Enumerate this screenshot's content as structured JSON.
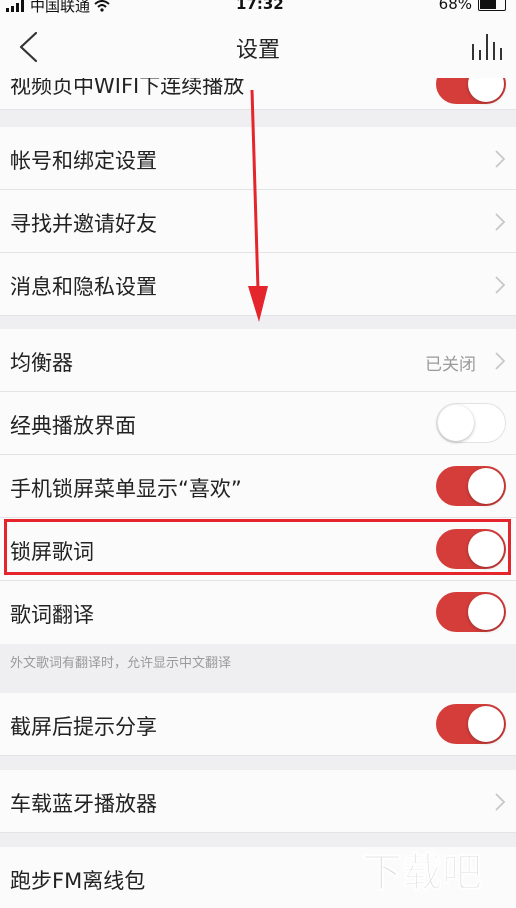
{
  "status_bar": {
    "carrier": "中国联通",
    "time": "17:32",
    "battery": "68%"
  },
  "header": {
    "title": "设置"
  },
  "rows": {
    "wifi_play": {
      "label": "视频页中WIFI下连续播放",
      "on": true
    },
    "account": {
      "label": "帐号和绑定设置"
    },
    "invite": {
      "label": "寻找并邀请好友"
    },
    "privacy": {
      "label": "消息和隐私设置"
    },
    "equalizer": {
      "label": "均衡器",
      "status": "已关闭"
    },
    "classic_ui": {
      "label": "经典播放界面",
      "on": false
    },
    "lock_like": {
      "label": "手机锁屏菜单显示“喜欢”",
      "on": true
    },
    "lock_lyrics": {
      "label": "锁屏歌词",
      "on": true
    },
    "lyric_translate": {
      "label": "歌词翻译",
      "on": true,
      "hint": "外文歌词有翻译时，允许显示中文翻译"
    },
    "screenshot_share": {
      "label": "截屏后提示分享",
      "on": true
    },
    "car_bluetooth": {
      "label": "车载蓝牙播放器"
    },
    "run_fm": {
      "label": "跑步FM离线包"
    }
  },
  "colors": {
    "accent": "#d43d3a",
    "highlight": "#e4262c",
    "background": "#efeff1"
  },
  "icons": [
    "back-icon",
    "chart-icon",
    "chevron-right-icon",
    "wifi-icon",
    "signal-icon",
    "battery-icon"
  ]
}
